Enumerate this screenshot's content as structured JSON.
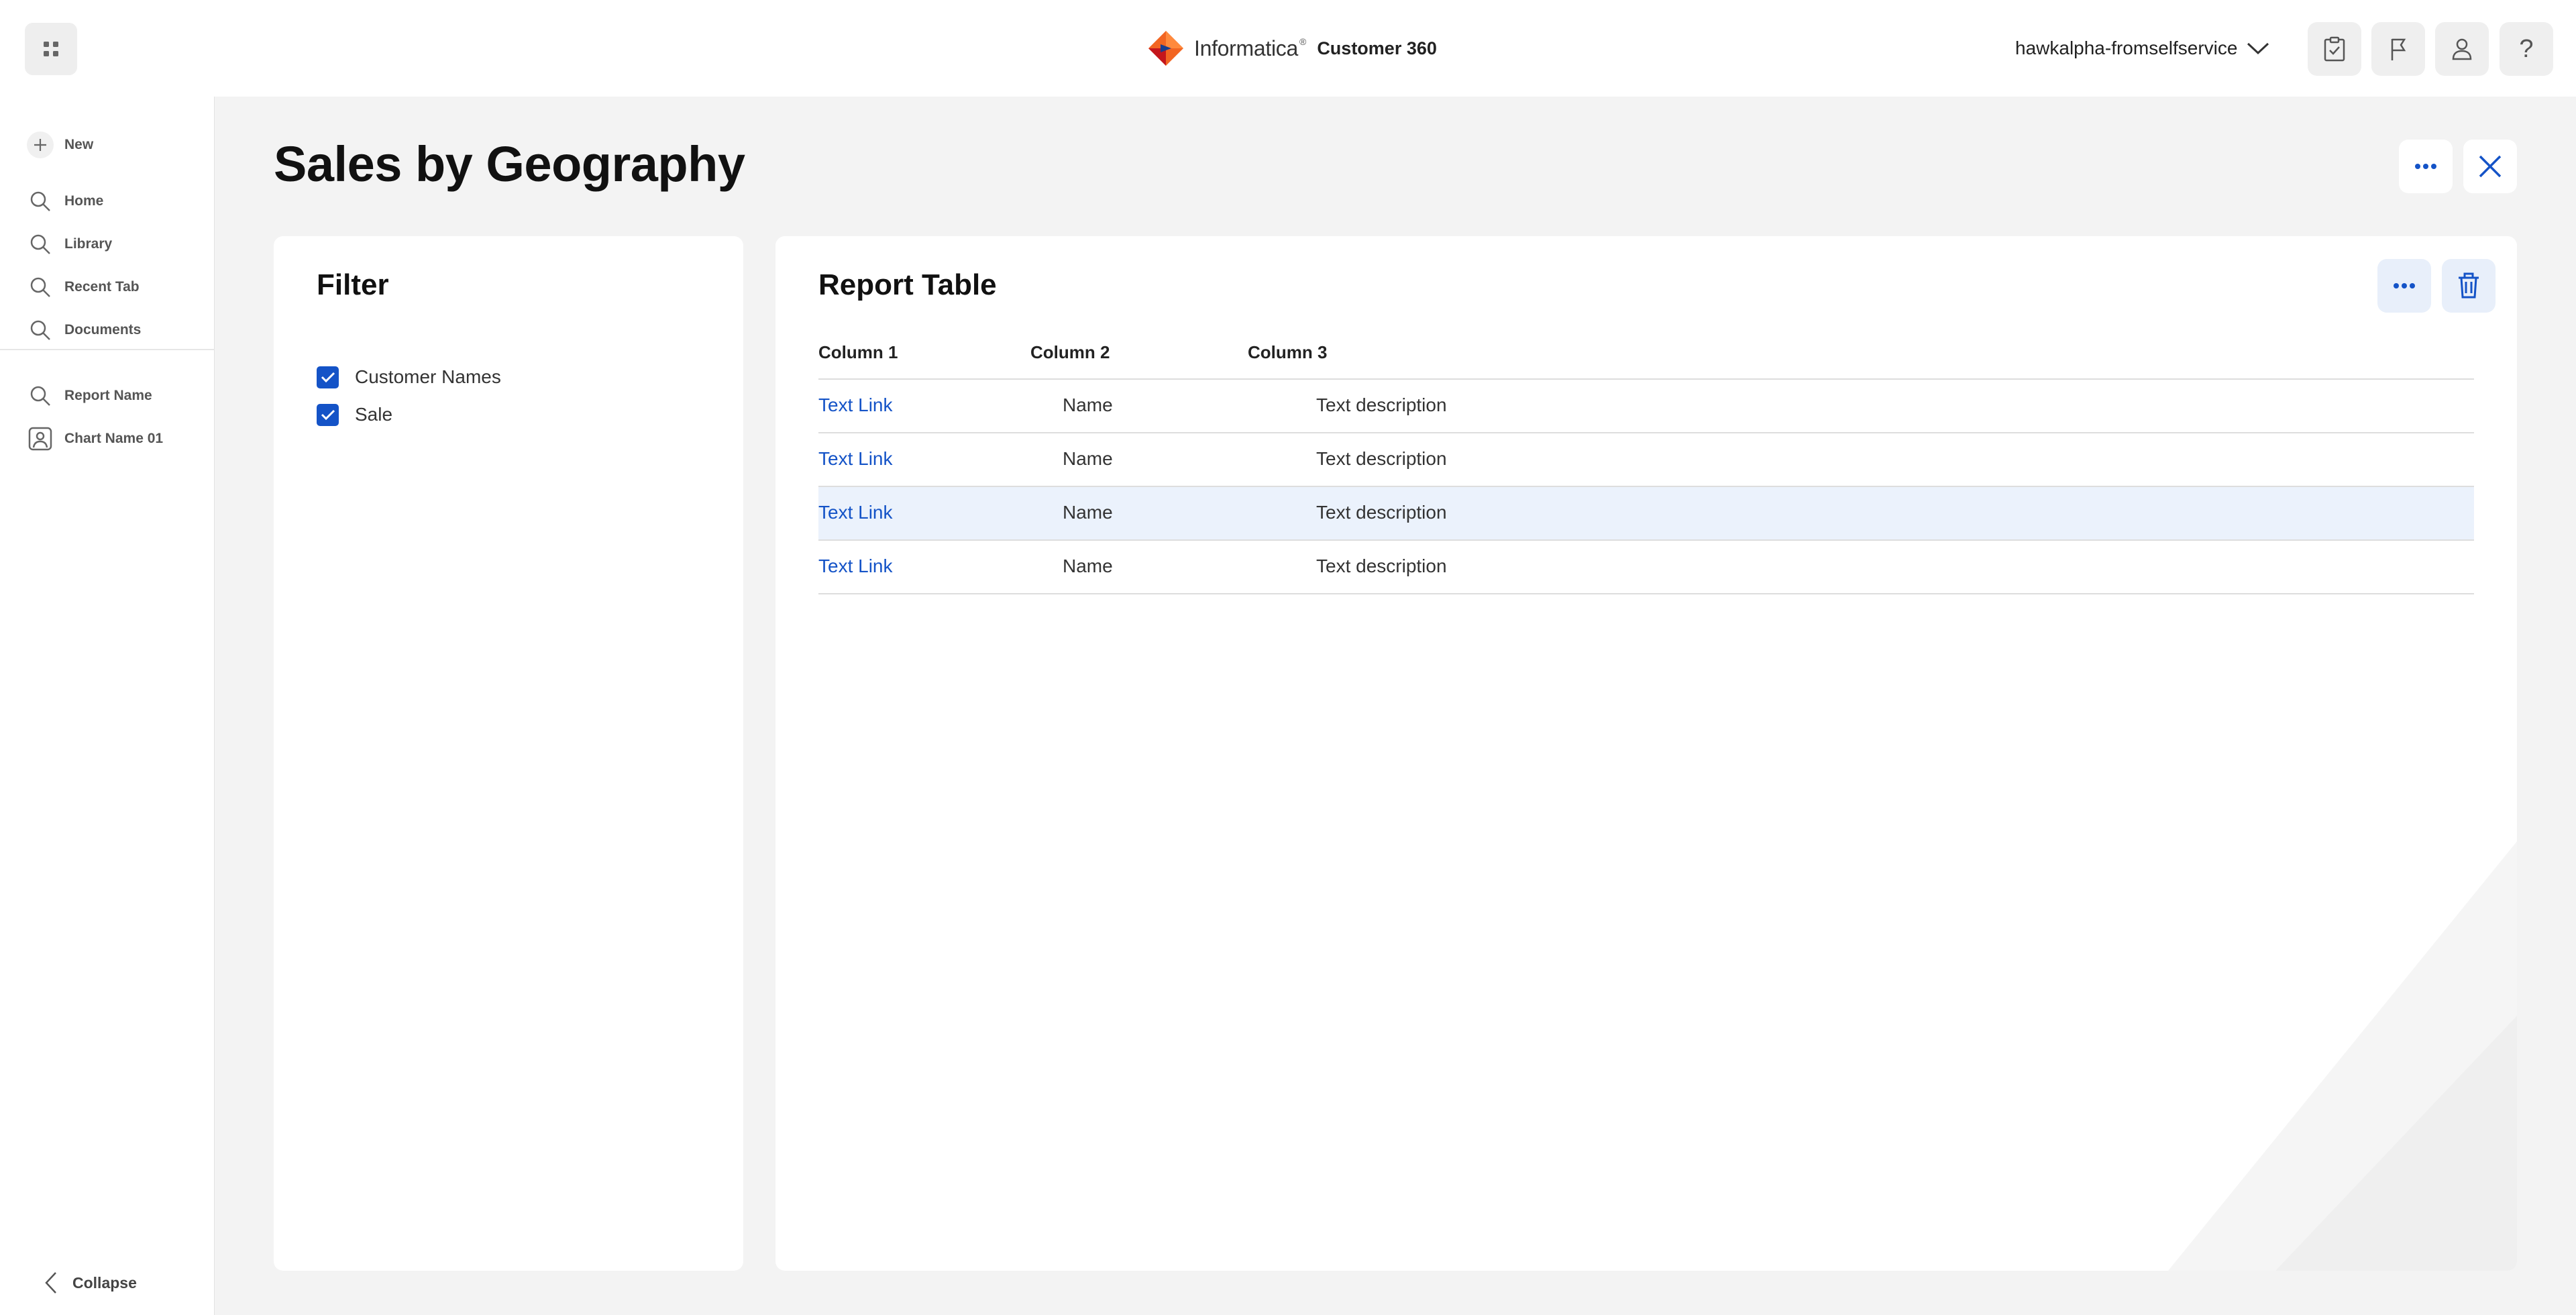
{
  "header": {
    "brand_name": "Informatica",
    "brand_mark": "®",
    "product": "Customer 360",
    "org": "hawkalpha-fromselfservice",
    "icons": [
      "apps-grid-icon",
      "checklist-icon",
      "flag-icon",
      "user-icon",
      "help-icon"
    ]
  },
  "sidebar": {
    "new_label": "New",
    "items": [
      {
        "label": "Home",
        "icon": "search-icon"
      },
      {
        "label": "Library",
        "icon": "search-icon"
      },
      {
        "label": "Recent Tab",
        "icon": "search-icon"
      },
      {
        "label": "Documents",
        "icon": "search-icon"
      }
    ],
    "reports": [
      {
        "label": "Report Name",
        "icon": "search-icon"
      },
      {
        "label": "Chart Name 01",
        "icon": "user-card-icon"
      }
    ],
    "collapse_label": "Collapse"
  },
  "page": {
    "title": "Sales by Geography"
  },
  "filter": {
    "title": "Filter",
    "options": [
      {
        "label": "Customer Names",
        "checked": true
      },
      {
        "label": "Sale",
        "checked": true
      }
    ]
  },
  "report": {
    "title": "Report Table",
    "columns": [
      "Column 1",
      "Column 2",
      "Column 3"
    ],
    "rows": [
      [
        "Text Link",
        "Name",
        "Text description"
      ],
      [
        "Text Link",
        "Name",
        "Text description"
      ],
      [
        "Text Link",
        "Name",
        "Text description"
      ],
      [
        "Text Link",
        "Name",
        "Text description"
      ]
    ],
    "highlighted_row": 2
  },
  "colors": {
    "accent": "#1453c7",
    "row_highlight": "#ebf2fc",
    "background": "#f3f3f3"
  }
}
